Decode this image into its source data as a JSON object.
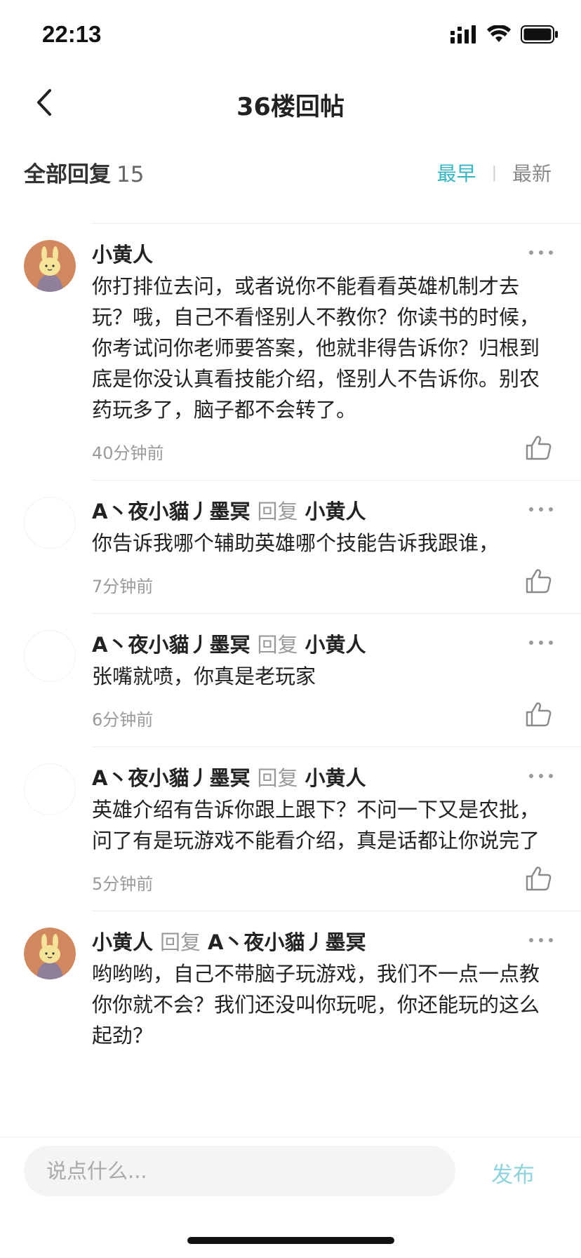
{
  "status_bar": {
    "time": "22:13"
  },
  "nav": {
    "title": "36楼回帖"
  },
  "header": {
    "label": "全部回复",
    "count": "15",
    "sort_earliest": "最早",
    "sort_latest": "最新"
  },
  "comments": [
    {
      "author": "小黄人",
      "reply_word": "",
      "target": "",
      "text": "你打排位去问，或者说你不能看看英雄机制才去玩？哦，自己不看怪别人不教你？你读书的时候，你考试问你老师要答案，他就非得告诉你？归根到底是你没认真看技能介绍，怪别人不告诉你。别农药玩多了，脑子都不会转了。",
      "time": "40分钟前"
    },
    {
      "author": "A丶夜小貓丿墨冥",
      "reply_word": "回复",
      "target": "小黄人",
      "text": "你告诉我哪个辅助英雄哪个技能告诉我跟谁，",
      "time": "7分钟前"
    },
    {
      "author": "A丶夜小貓丿墨冥",
      "reply_word": "回复",
      "target": "小黄人",
      "text": "张嘴就喷，你真是老玩家",
      "time": "6分钟前"
    },
    {
      "author": "A丶夜小貓丿墨冥",
      "reply_word": "回复",
      "target": "小黄人",
      "text": "英雄介绍有告诉你跟上跟下？不问一下又是农批，问了有是玩游戏不能看介绍，真是话都让你说完了",
      "time": "5分钟前"
    },
    {
      "author": "小黄人",
      "reply_word": "回复",
      "target": "A丶夜小貓丿墨冥",
      "text": "哟哟哟，自己不带脑子玩游戏，我们不一点一点教你你就不会？我们还没叫你玩呢，你还能玩的这么起劲？",
      "time": ""
    }
  ],
  "bottom": {
    "input_placeholder": "说点什么...",
    "publish_label": "发布"
  },
  "colors": {
    "accent": "#35b5c4",
    "publish": "#8fd3dc",
    "muted": "#9a9a9a"
  },
  "icons": {
    "back": "chevron-left-icon",
    "more": "more-dots-icon",
    "like": "thumbs-up-icon",
    "avatar": "bunny-avatar-icon"
  }
}
